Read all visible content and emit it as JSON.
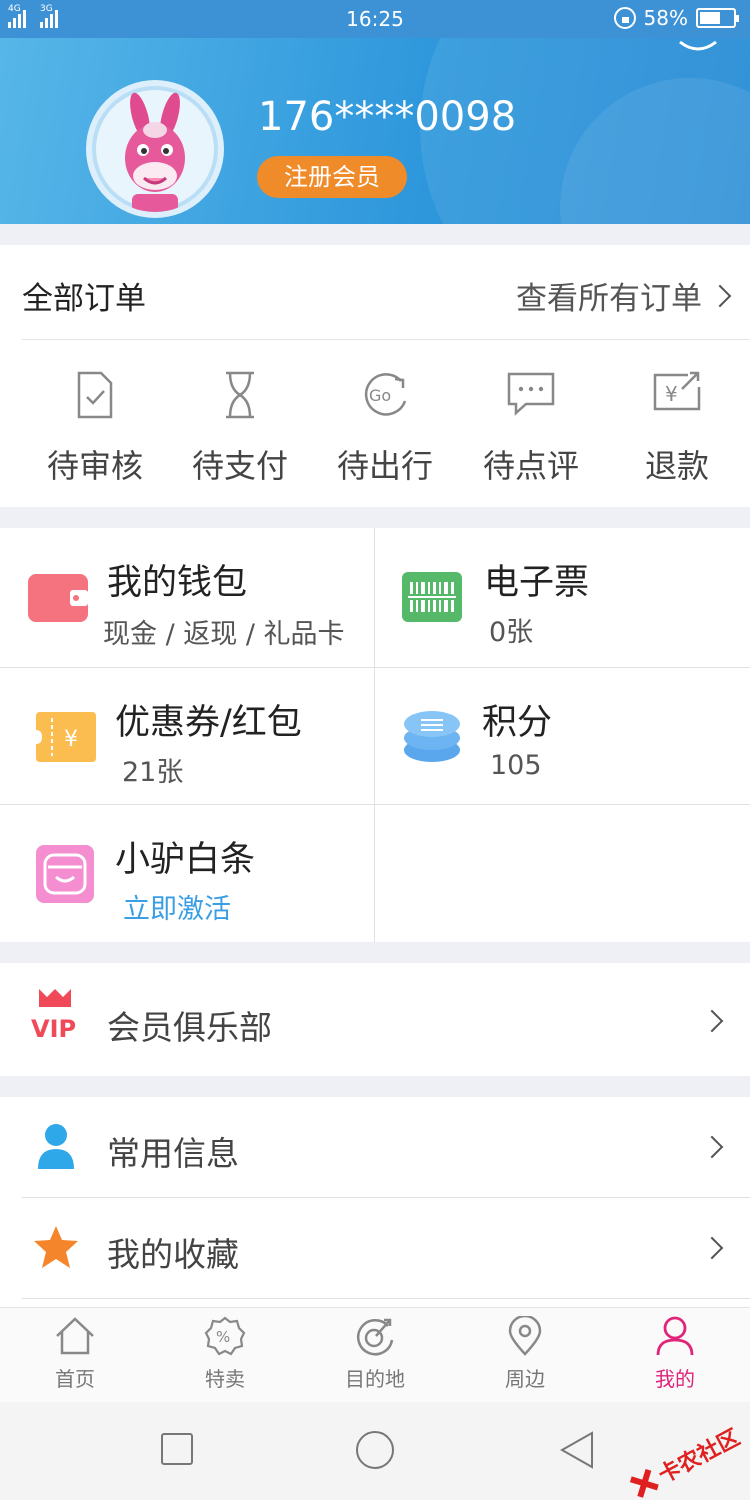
{
  "status_bar": {
    "sim1": "4G",
    "sim2": "3G",
    "time": "16:25",
    "battery": "58%"
  },
  "profile": {
    "phone": "176****0098",
    "member_button": "注册会员"
  },
  "orders": {
    "title": "全部订单",
    "view_all": "查看所有订单",
    "statuses": [
      {
        "label": "待审核",
        "icon": "doc-check-icon"
      },
      {
        "label": "待支付",
        "icon": "hourglass-icon"
      },
      {
        "label": "待出行",
        "icon": "go-icon"
      },
      {
        "label": "待点评",
        "icon": "comment-icon"
      },
      {
        "label": "退款",
        "icon": "refund-icon"
      }
    ]
  },
  "assets": {
    "wallet": {
      "title": "我的钱包",
      "sub": "现金 / 返现 / 礼品卡"
    },
    "eticket": {
      "title": "电子票",
      "sub": "0张"
    },
    "coupon": {
      "title": "优惠券/红包",
      "sub": "21张"
    },
    "points": {
      "title": "积分",
      "sub": "105"
    },
    "credit": {
      "title": "小驴白条",
      "sub": "立即激活"
    }
  },
  "menu": {
    "vip_club": "会员俱乐部",
    "vip_badge": "VIP",
    "common_info": "常用信息",
    "favorites": "我的收藏"
  },
  "tabs": [
    {
      "label": "首页",
      "icon": "home-icon"
    },
    {
      "label": "特卖",
      "icon": "sale-icon"
    },
    {
      "label": "目的地",
      "icon": "destination-icon"
    },
    {
      "label": "周边",
      "icon": "nearby-icon"
    },
    {
      "label": "我的",
      "icon": "profile-icon"
    }
  ],
  "watermark": "卡农社区",
  "colors": {
    "header_blue": "#2f98dc",
    "member_orange": "#f08b2a",
    "active_tab": "#e0247a",
    "link_blue": "#3a9ee4"
  }
}
